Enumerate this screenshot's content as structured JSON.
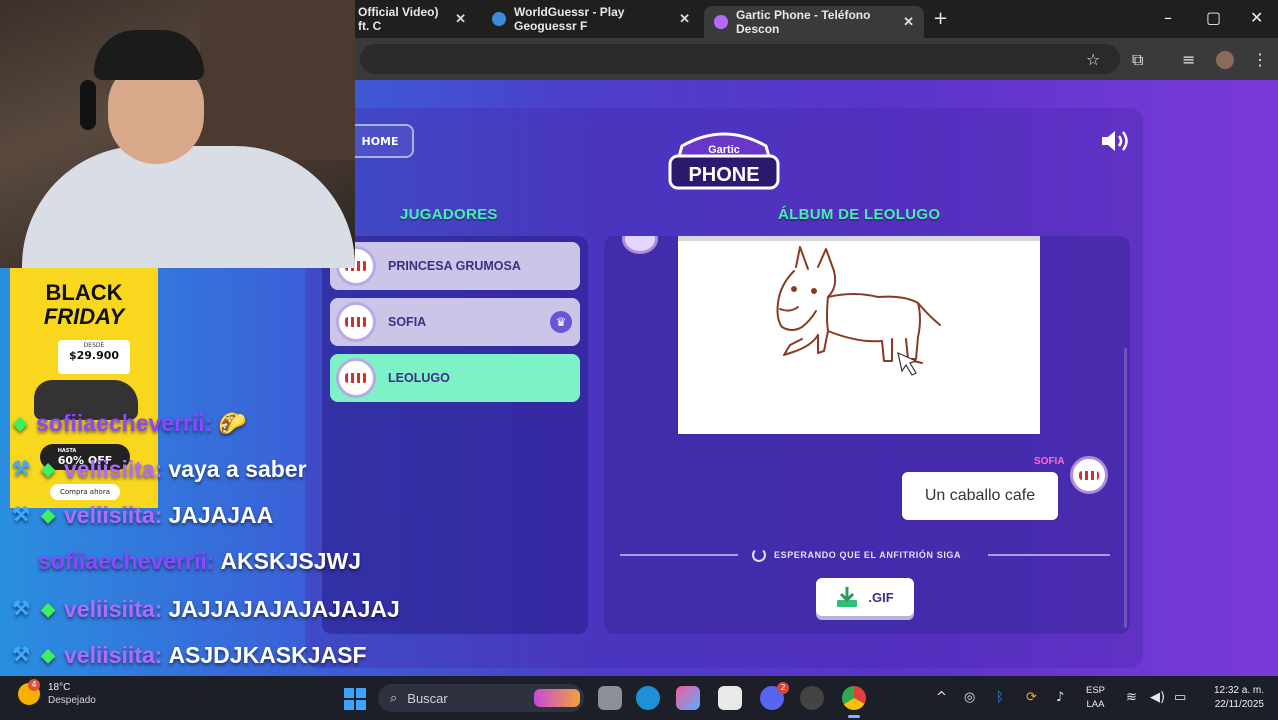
{
  "browser": {
    "tabs": [
      {
        "title": "Official Video) ft. C",
        "favicon": "music-icon"
      },
      {
        "title": "WorldGuessr - Play Geoguessr F",
        "favicon": "globe-icon"
      },
      {
        "title": "Gartic Phone - Teléfono Descon",
        "favicon": "phone-icon",
        "active": true
      }
    ],
    "new_tab": "+"
  },
  "game": {
    "home_label": "HOME",
    "logo_top": "Gartic",
    "logo_bottom": "PHONE",
    "players_title": "JUGADORES",
    "album_title": "ÁLBUM DE LEOLUGO",
    "players": [
      {
        "name": "PRINCESA GRUMOSA",
        "is_host": false,
        "is_me": false
      },
      {
        "name": "SOFIA",
        "is_host": true,
        "is_me": false
      },
      {
        "name": "LEOLUGO",
        "is_host": false,
        "is_me": true
      }
    ],
    "album": {
      "drawing_subject": "horse",
      "author": "SOFIA",
      "caption": "Un caballo cafe",
      "waiting_text": "ESPERANDO QUE EL ANFITRIÓN SIGA",
      "gif_label": ".GIF"
    },
    "accent_color": "#44f1a8"
  },
  "overlay": {
    "ad": {
      "line1": "BLACK",
      "line2": "FRIDAY",
      "price_prefix": "DESDE",
      "price": "$29.900",
      "discount_prefix": "HASTA",
      "discount": "60% OFF",
      "cta": "Compra ahora"
    },
    "chat": [
      {
        "user": "sofiiaecheverrii:",
        "message": "🌮",
        "badges": [
          "gem"
        ]
      },
      {
        "user": "veliisiita:",
        "message": "vaya a saber",
        "badges": [
          "pick",
          "gem"
        ]
      },
      {
        "user": "veliisiita:",
        "message": "JAJAJAA",
        "badges": [
          "pick",
          "gem"
        ]
      },
      {
        "user": "sofiiaecheverrii:",
        "message": "AKSKJSJWJ",
        "badges": []
      },
      {
        "user": "veliisiita:",
        "message": "JAJJAJAJAJAJAJAJ",
        "badges": [
          "pick",
          "gem"
        ]
      },
      {
        "user": "veliisiita:",
        "message": "ASJDJKASKJASF",
        "badges": [
          "pick",
          "gem"
        ]
      }
    ]
  },
  "taskbar": {
    "weather": {
      "temp": "18°C",
      "condition": "Despejado",
      "badge": "4"
    },
    "search_placeholder": "Buscar",
    "discord_badge": "2",
    "lang": [
      "ESP",
      "LAA"
    ],
    "time": "12:32 a. m.",
    "date": "22/11/2025"
  }
}
